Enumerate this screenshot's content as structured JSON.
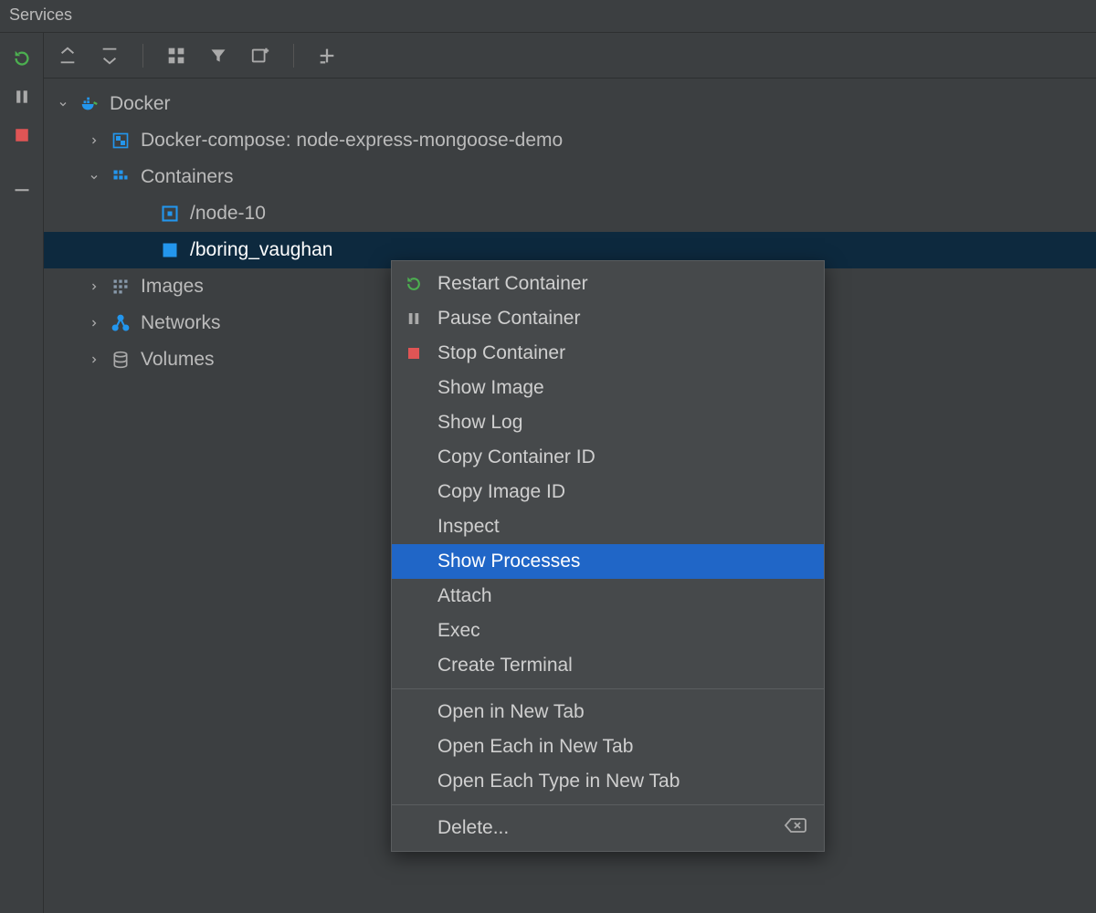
{
  "panel": {
    "title": "Services"
  },
  "tree": {
    "root": {
      "label": "Docker"
    },
    "compose": {
      "label": "Docker-compose: node-express-mongoose-demo"
    },
    "containers": {
      "label": "Containers"
    },
    "container_items": [
      {
        "label": "/node-10"
      },
      {
        "label": "/boring_vaughan"
      }
    ],
    "images": {
      "label": "Images"
    },
    "networks": {
      "label": "Networks"
    },
    "volumes": {
      "label": "Volumes"
    }
  },
  "context_menu": {
    "items": [
      {
        "label": "Restart Container",
        "icon": "restart"
      },
      {
        "label": "Pause Container",
        "icon": "pause"
      },
      {
        "label": "Stop Container",
        "icon": "stop"
      },
      {
        "label": "Show Image"
      },
      {
        "label": "Show Log"
      },
      {
        "label": "Copy Container ID"
      },
      {
        "label": "Copy Image ID"
      },
      {
        "label": "Inspect"
      },
      {
        "label": "Show Processes",
        "highlight": true
      },
      {
        "label": "Attach"
      },
      {
        "label": "Exec"
      },
      {
        "label": "Create Terminal"
      }
    ],
    "group2": [
      {
        "label": "Open in New Tab"
      },
      {
        "label": "Open Each in New Tab"
      },
      {
        "label": "Open Each Type in New Tab"
      }
    ],
    "group3": [
      {
        "label": "Delete...",
        "shortcut_icon": "delete-key"
      }
    ]
  }
}
